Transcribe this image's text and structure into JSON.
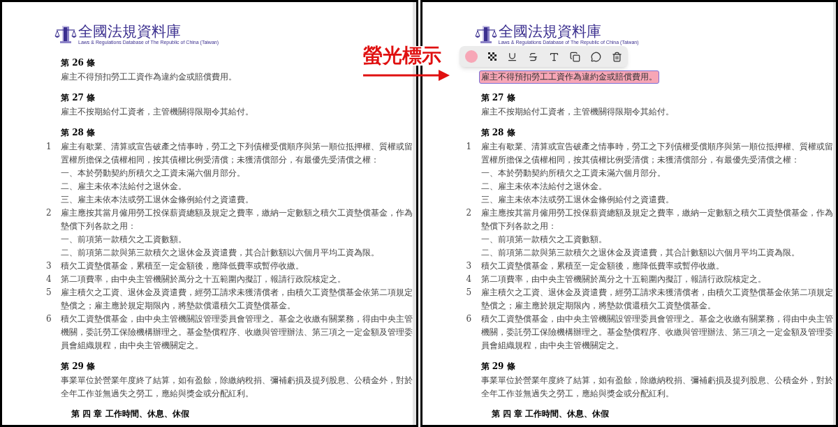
{
  "callout": {
    "text": "螢光標示"
  },
  "panes": [
    {
      "logo": {
        "title": "全國法規資料庫",
        "subtitle": "Laws & Regulations Database of The Republic of China (Taiwan)"
      },
      "articles": [
        {
          "heading": "第 26 條",
          "highlighted": false,
          "paragraphs": [
            {
              "lines": [
                "雇主不得預扣勞工工資作為違約金或賠償費用。"
              ]
            }
          ]
        },
        {
          "heading": "第 27 條",
          "highlighted": false,
          "paragraphs": [
            {
              "lines": [
                "雇主不按期給付工資者，主管機關得限期令其給付。"
              ]
            }
          ]
        },
        {
          "heading": "第 28 條",
          "highlighted": false,
          "paragraphs": [
            {
              "number": "1",
              "lines": [
                "雇主有歇業、清算或宣告破產之情事時，勞工之下列債權受償順序與第一順位抵押權、質權或留",
                "置權所擔保之債權相同，按其債權比例受清償；未獲清償部分，有最優先受清償之權：",
                "一、本於勞動契約所積欠之工資未滿六個月部分。",
                "二、雇主未依本法給付之退休金。",
                "三、雇主未依本法或勞工退休金條例給付之資遣費。"
              ]
            },
            {
              "number": "2",
              "lines": [
                "雇主應按其當月僱用勞工投保薪資總額及規定之費率，繳納一定數額之積欠工資墊償基金，作為",
                "墊償下列各款之用：",
                "一、前項第一款積欠之工資數額。",
                "二、前項第二款與第三款積欠之退休金及資遣費，其合計數額以六個月平均工資為限。"
              ]
            },
            {
              "number": "3",
              "lines": [
                "積欠工資墊償基金，累積至一定金額後，應降低費率或暫停收繳。"
              ]
            },
            {
              "number": "4",
              "lines": [
                "第二項費率，由中央主管機關於萬分之十五範圍內擬訂，報請行政院核定之。"
              ]
            },
            {
              "number": "5",
              "lines": [
                "雇主積欠之工資、退休金及資遣費，經勞工請求未獲清償者，由積欠工資墊償基金依第二項規定",
                "墊償之；雇主應於規定期限內，將墊款償還積欠工資墊償基金。"
              ]
            },
            {
              "number": "6",
              "lines": [
                "積欠工資墊償基金，由中央主管機關設管理委員會管理之。基金之收繳有關業務，得由中央主管",
                "機關，委託勞工保險機構辦理之。基金墊償程序、收繳與管理辦法、第三項之一定金額及管理委",
                "員會組織規程，由中央主管機關定之。"
              ]
            }
          ]
        },
        {
          "heading": "第 29 條",
          "highlighted": false,
          "paragraphs": [
            {
              "lines": [
                "事業單位於營業年度終了結算，如有盈餘，除繳納稅捐、彌補虧損及提列股息、公積金外，對於",
                "全年工作並無過失之勞工，應給與獎金或分配紅利。"
              ]
            }
          ]
        }
      ],
      "chapter": "第 四 章 工作時間、休息、休假"
    },
    {
      "logo": {
        "title": "全國法規資料庫",
        "subtitle": "Laws & Regulations Database of The Republic of China (Taiwan)"
      },
      "annotation_toolbar": {
        "color": "#f7a6b6"
      },
      "articles": [
        {
          "highlighted": true,
          "paragraphs": [
            {
              "lines": [
                "雇主不得預扣勞工工資作為違約金或賠償費用。"
              ]
            }
          ]
        },
        {
          "heading": "第 27 條",
          "highlighted": false,
          "paragraphs": [
            {
              "lines": [
                "雇主不按期給付工資者，主管機關得限期令其給付。"
              ]
            }
          ]
        },
        {
          "heading": "第 28 條",
          "highlighted": false,
          "paragraphs": [
            {
              "number": "1",
              "lines": [
                "雇主有歇業、清算或宣告破產之情事時，勞工之下列債權受償順序與第一順位抵押權、質權或留",
                "置權所擔保之債權相同，按其債權比例受清償；未獲清償部分，有最優先受清償之權：",
                "一、本於勞動契約所積欠之工資未滿六個月部分。",
                "二、雇主未依本法給付之退休金。",
                "三、雇主未依本法或勞工退休金條例給付之資遣費。"
              ]
            },
            {
              "number": "2",
              "lines": [
                "雇主應按其當月僱用勞工投保薪資總額及規定之費率，繳納一定數額之積欠工資墊償基金，作為",
                "墊償下列各款之用：",
                "一、前項第一款積欠之工資數額。",
                "二、前項第二款與第三款積欠之退休金及資遣費，其合計數額以六個月平均工資為限。"
              ]
            },
            {
              "number": "3",
              "lines": [
                "積欠工資墊償基金，累積至一定金額後，應降低費率或暫停收繳。"
              ]
            },
            {
              "number": "4",
              "lines": [
                "第二項費率，由中央主管機關於萬分之十五範圍內擬訂，報請行政院核定之。"
              ]
            },
            {
              "number": "5",
              "lines": [
                "雇主積欠之工資、退休金及資遣費，經勞工請求未獲清償者，由積欠工資墊償基金依第二項規定",
                "墊償之；雇主應於規定期限內，將墊款償還積欠工資墊償基金。"
              ]
            },
            {
              "number": "6",
              "lines": [
                "積欠工資墊償基金，由中央主管機關設管理委員會管理之。基金之收繳有關業務，得由中央主管",
                "機關，委託勞工保險機構辦理之。基金墊償程序、收繳與管理辦法、第三項之一定金額及管理委",
                "員會組織規程，由中央主管機關定之。"
              ]
            }
          ]
        },
        {
          "heading": "第 29 條",
          "highlighted": false,
          "paragraphs": [
            {
              "lines": [
                "事業單位於營業年度終了結算，如有盈餘，除繳納稅捐、彌補虧損及提列股息、公積金外，對於",
                "全年工作並無過失之勞工，應給與獎金或分配紅利。"
              ]
            }
          ]
        }
      ],
      "chapter": "第 四 章 工作時間、休息、休假"
    }
  ]
}
